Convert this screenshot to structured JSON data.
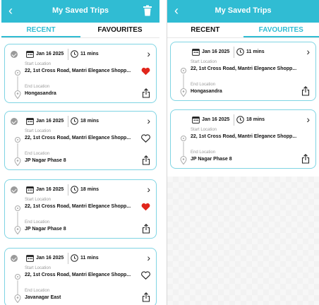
{
  "colors": {
    "accent": "#30bcd3",
    "favorite_heart": "#e1261c",
    "card_border": "#7fd4e3"
  },
  "screens": [
    {
      "header": {
        "title": "My Saved Trips",
        "back_icon": "chevron-left-icon",
        "action_icon": "trash-icon"
      },
      "tabs": [
        {
          "label": "RECENT",
          "active": true
        },
        {
          "label": "FAVOURITES",
          "active": false
        }
      ],
      "trips": [
        {
          "date": "Jan 16 2025",
          "duration": "11 mins",
          "start_label": "Start Location",
          "start_address": "22, 1st Cross Road, Mantri Elegance Shopp...",
          "end_label": "End Location",
          "end_address": "Hongasandra",
          "favourite": true
        },
        {
          "date": "Jan 16 2025",
          "duration": "18 mins",
          "start_label": "Start Location",
          "start_address": "22, 1st Cross Road, Mantri Elegance Shopp...",
          "end_label": "End Location",
          "end_address": "JP Nagar Phase 8",
          "favourite": false
        },
        {
          "date": "Jan 16 2025",
          "duration": "18 mins",
          "start_label": "Start Location",
          "start_address": "22, 1st Cross Road, Mantri Elegance Shopp...",
          "end_label": "End Location",
          "end_address": "JP Nagar Phase 8",
          "favourite": true
        },
        {
          "date": "Jan 16 2025",
          "duration": "11 mins",
          "start_label": "Start Location",
          "start_address": "22, 1st Cross Road, Mantri Elegance Shopp...",
          "end_label": "End Location",
          "end_address": "Javanagar East",
          "favourite": false
        }
      ]
    },
    {
      "header": {
        "title": "My Saved Trips",
        "back_icon": "chevron-left-icon"
      },
      "tabs": [
        {
          "label": "RECENT",
          "active": false
        },
        {
          "label": "FAVOURITES",
          "active": true
        }
      ],
      "trips": [
        {
          "date": "Jan 16 2025",
          "duration": "11 mins",
          "start_label": "Start Location",
          "start_address": "22, 1st Cross Road, Mantri Elegance Shopp...",
          "end_label": "End Location",
          "end_address": "Hongasandra"
        },
        {
          "date": "Jan 16 2025",
          "duration": "18 mins",
          "start_label": "Start Location",
          "start_address": "22, 1st Cross Road, Mantri Elegance Shopp...",
          "end_label": "End Location",
          "end_address": "JP Nagar Phase 8"
        }
      ]
    }
  ]
}
